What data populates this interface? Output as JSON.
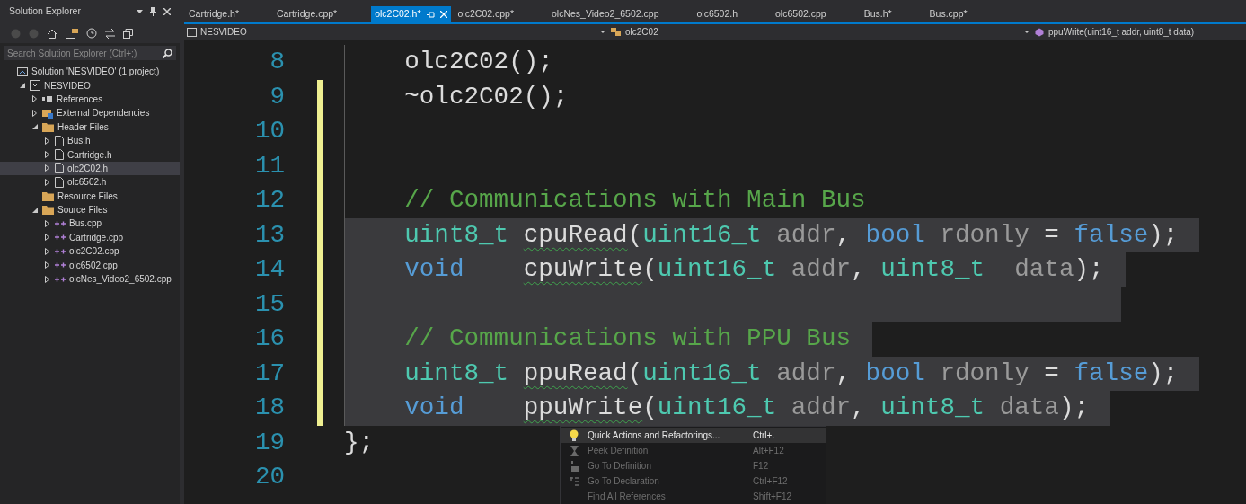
{
  "solution_explorer": {
    "title": "Solution Explorer",
    "search": {
      "placeholder": "Search Solution Explorer (Ctrl+;)"
    },
    "tree": [
      {
        "label": "Solution 'NESVIDEO' (1 project)",
        "kind": "solution",
        "selected": false,
        "children": [
          {
            "label": "NESVIDEO",
            "kind": "project",
            "selected": false,
            "expanded": true,
            "children": [
              {
                "label": "References",
                "kind": "references",
                "selected": false,
                "expanded": false
              },
              {
                "label": "External Dependencies",
                "kind": "external",
                "selected": false,
                "expanded": false
              },
              {
                "label": "Header Files",
                "kind": "folder",
                "selected": false,
                "expanded": true,
                "children": [
                  {
                    "label": "Bus.h",
                    "kind": "header",
                    "selected": false,
                    "expanded": false
                  },
                  {
                    "label": "Cartridge.h",
                    "kind": "header",
                    "selected": false,
                    "expanded": false
                  },
                  {
                    "label": "olc2C02.h",
                    "kind": "header",
                    "selected": true,
                    "expanded": false
                  },
                  {
                    "label": "olc6502.h",
                    "kind": "header",
                    "selected": false,
                    "expanded": false
                  }
                ]
              },
              {
                "label": "Resource Files",
                "kind": "folder",
                "selected": false
              },
              {
                "label": "Source Files",
                "kind": "folder",
                "selected": false,
                "expanded": true,
                "children": [
                  {
                    "label": "Bus.cpp",
                    "kind": "source",
                    "selected": false,
                    "expanded": false
                  },
                  {
                    "label": "Cartridge.cpp",
                    "kind": "source",
                    "selected": false,
                    "expanded": false
                  },
                  {
                    "label": "olc2C02.cpp",
                    "kind": "source",
                    "selected": false,
                    "expanded": false
                  },
                  {
                    "label": "olc6502.cpp",
                    "kind": "source",
                    "selected": false,
                    "expanded": false
                  },
                  {
                    "label": "olcNes_Video2_6502.cpp",
                    "kind": "source",
                    "selected": false,
                    "expanded": false
                  }
                ]
              }
            ]
          }
        ]
      }
    ]
  },
  "tabs": [
    {
      "label": "Cartridge.h*",
      "selected": false
    },
    {
      "label": "Cartridge.cpp*",
      "selected": false
    },
    {
      "label": "olc2C02.h*",
      "selected": true
    },
    {
      "label": "olc2C02.cpp*",
      "selected": false
    },
    {
      "label": "olcNes_Video2_6502.cpp",
      "selected": false
    },
    {
      "label": "olc6502.h",
      "selected": false
    },
    {
      "label": "olc6502.cpp",
      "selected": false
    },
    {
      "label": "Bus.h*",
      "selected": false
    },
    {
      "label": "Bus.cpp*",
      "selected": false
    }
  ],
  "navigation": {
    "project": "NESVIDEO",
    "scope": "olc2C02",
    "member": "ppuWrite(uint16_t addr, uint8_t data)"
  },
  "code": [
    {
      "number": "8",
      "modified": false,
      "selected": false,
      "tokens": [
        {
          "t": "    olc2C02();",
          "kind": "plain"
        }
      ]
    },
    {
      "number": "9",
      "modified": true,
      "selected": false,
      "tokens": [
        {
          "t": "    ~olc2C02();",
          "kind": "plain"
        }
      ]
    },
    {
      "number": "10",
      "modified": true,
      "selected": false
    },
    {
      "number": "11",
      "modified": true,
      "selected": false
    },
    {
      "number": "12",
      "modified": true,
      "selected": false,
      "tokens": [
        {
          "t": "    // Communications with Main Bus",
          "kind": "comment"
        }
      ]
    },
    {
      "number": "13",
      "modified": true,
      "selected": true,
      "tokens": [
        {
          "t": "    uint8_t ",
          "kind": "type"
        },
        {
          "t": "cpuRead",
          "kind": "plain",
          "squiggle": true
        },
        {
          "t": "(",
          "kind": "plain"
        },
        {
          "t": "uint16_t",
          "kind": "type"
        },
        {
          "t": " addr",
          "kind": "param"
        },
        {
          "t": ", ",
          "kind": "plain"
        },
        {
          "t": "bool",
          "kind": "keyword"
        },
        {
          "t": " rdonly",
          "kind": "param"
        },
        {
          "t": " = ",
          "kind": "plain"
        },
        {
          "t": "false",
          "kind": "keyword"
        },
        {
          "t": ");",
          "kind": "plain"
        }
      ]
    },
    {
      "number": "14",
      "modified": true,
      "selected": true,
      "tokens": [
        {
          "t": "    void    ",
          "kind": "keyword"
        },
        {
          "t": "cpuWrite",
          "kind": "plain",
          "squiggle": true
        },
        {
          "t": "(",
          "kind": "plain"
        },
        {
          "t": "uint16_t",
          "kind": "type"
        },
        {
          "t": " addr",
          "kind": "param"
        },
        {
          "t": ", ",
          "kind": "plain"
        },
        {
          "t": "uint8_t",
          "kind": "type"
        },
        {
          "t": "  data",
          "kind": "param"
        },
        {
          "t": ");",
          "kind": "plain"
        }
      ]
    },
    {
      "number": "15",
      "modified": true,
      "selected": true
    },
    {
      "number": "16",
      "modified": true,
      "selected": true,
      "tokens": [
        {
          "t": "    // Communications with PPU Bus",
          "kind": "comment"
        }
      ]
    },
    {
      "number": "17",
      "modified": true,
      "selected": true,
      "tokens": [
        {
          "t": "    uint8_t ",
          "kind": "type"
        },
        {
          "t": "ppuRead",
          "kind": "plain",
          "squiggle": true
        },
        {
          "t": "(",
          "kind": "plain"
        },
        {
          "t": "uint16_t",
          "kind": "type"
        },
        {
          "t": " addr",
          "kind": "param"
        },
        {
          "t": ", ",
          "kind": "plain"
        },
        {
          "t": "bool",
          "kind": "keyword"
        },
        {
          "t": " rdonly",
          "kind": "param"
        },
        {
          "t": " = ",
          "kind": "plain"
        },
        {
          "t": "false",
          "kind": "keyword"
        },
        {
          "t": ");",
          "kind": "plain"
        }
      ]
    },
    {
      "number": "18",
      "modified": true,
      "selected": true,
      "tokens": [
        {
          "t": "    void    ",
          "kind": "keyword"
        },
        {
          "t": "ppuWrite",
          "kind": "plain",
          "squiggle": true
        },
        {
          "t": "(",
          "kind": "plain"
        },
        {
          "t": "uint16_t",
          "kind": "type"
        },
        {
          "t": " addr",
          "kind": "param"
        },
        {
          "t": ", ",
          "kind": "plain"
        },
        {
          "t": "uint8_t",
          "kind": "type"
        },
        {
          "t": " data",
          "kind": "param"
        },
        {
          "t": ");",
          "kind": "plain"
        }
      ]
    },
    {
      "number": "19",
      "modified": false,
      "selected": false,
      "tokens": [
        {
          "t": "};",
          "kind": "plain"
        }
      ]
    },
    {
      "number": "20",
      "modified": false,
      "selected": false
    }
  ],
  "context_menu": [
    {
      "label": "Quick Actions and Refactorings...",
      "shortcut": "Ctrl+.",
      "kind": "lightbulb",
      "selected": true,
      "disabled": false
    },
    {
      "label": "Peek Definition",
      "shortcut": "Alt+F12",
      "kind": "peek",
      "selected": false,
      "disabled": true
    },
    {
      "label": "Go To Definition",
      "shortcut": "F12",
      "kind": "definition",
      "selected": false,
      "disabled": true
    },
    {
      "label": "Go To Declaration",
      "shortcut": "Ctrl+F12",
      "kind": "declaration",
      "selected": false,
      "disabled": true
    },
    {
      "label": "Find All References",
      "shortcut": "Shift+F12",
      "kind": "none",
      "selected": false,
      "disabled": true
    }
  ]
}
